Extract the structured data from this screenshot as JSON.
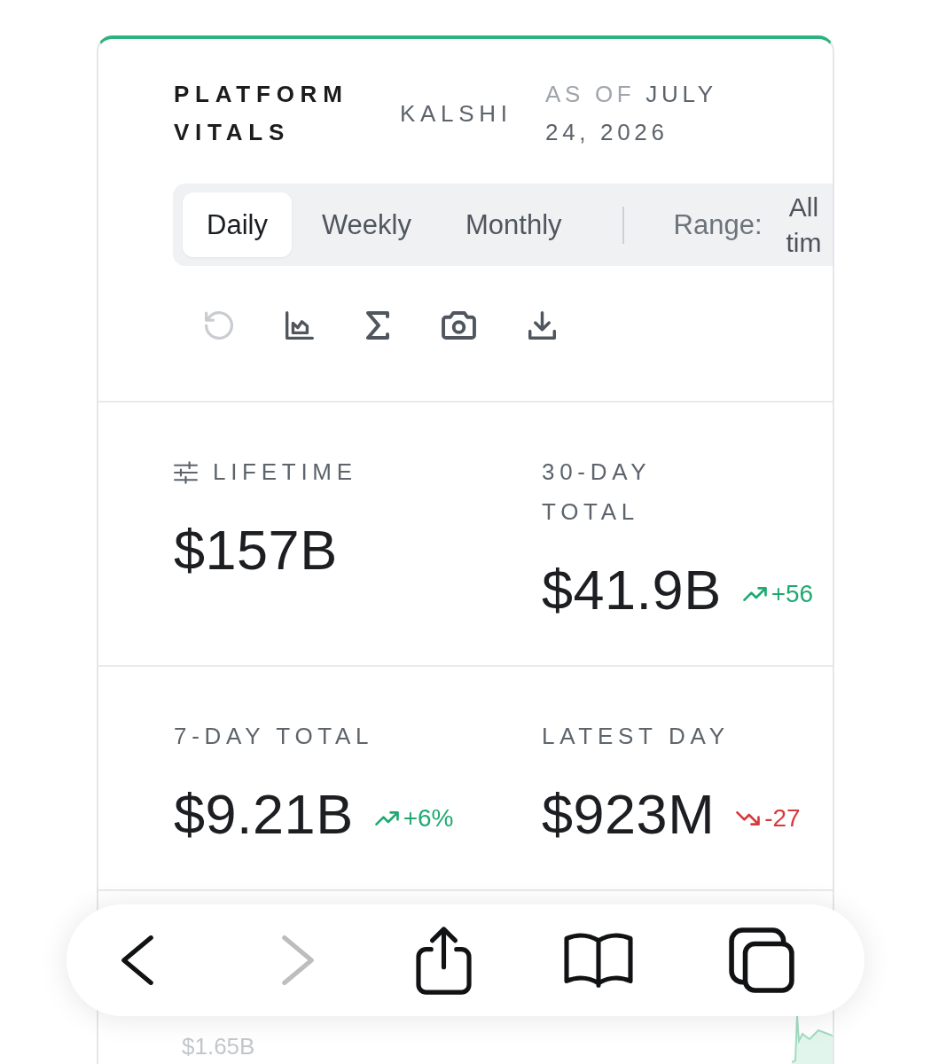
{
  "header": {
    "title": "PLATFORM VITALS",
    "source": "KALSHI",
    "as_of_label": "AS OF",
    "date": "JULY 24, 2026"
  },
  "tabs": [
    {
      "label": "Daily",
      "selected": true
    },
    {
      "label": "Weekly",
      "selected": false
    },
    {
      "label": "Monthly",
      "selected": false
    }
  ],
  "range": {
    "label": "Range:",
    "value": "All tim"
  },
  "toolbar": [
    {
      "kind": "reset",
      "disabled": true
    },
    {
      "kind": "chart",
      "disabled": false
    },
    {
      "kind": "sum",
      "disabled": false
    },
    {
      "kind": "snapshot",
      "disabled": false
    },
    {
      "kind": "download",
      "disabled": false
    }
  ],
  "metrics": [
    {
      "label": "LIFETIME",
      "adjustable": true,
      "value": "$157B"
    },
    {
      "label": "30-DAY TOTAL",
      "adjustable": false,
      "value": "$41.9B",
      "change": {
        "text": "+56",
        "kind": "up"
      }
    },
    {
      "label": "7-DAY TOTAL",
      "adjustable": false,
      "value": "$9.21B",
      "change": {
        "text": "+6%",
        "kind": "up"
      }
    },
    {
      "label": "LATEST DAY",
      "adjustable": false,
      "value": "$923M",
      "change": {
        "text": "-27",
        "kind": "down"
      }
    }
  ],
  "chart": {
    "axis_label": "$1.65B"
  },
  "browser_toolbar": [
    {
      "kind": "back",
      "disabled": false
    },
    {
      "kind": "forward",
      "disabled": true
    },
    {
      "kind": "share",
      "disabled": false
    },
    {
      "kind": "bookmarks",
      "disabled": false
    },
    {
      "kind": "tabs",
      "disabled": false
    }
  ]
}
